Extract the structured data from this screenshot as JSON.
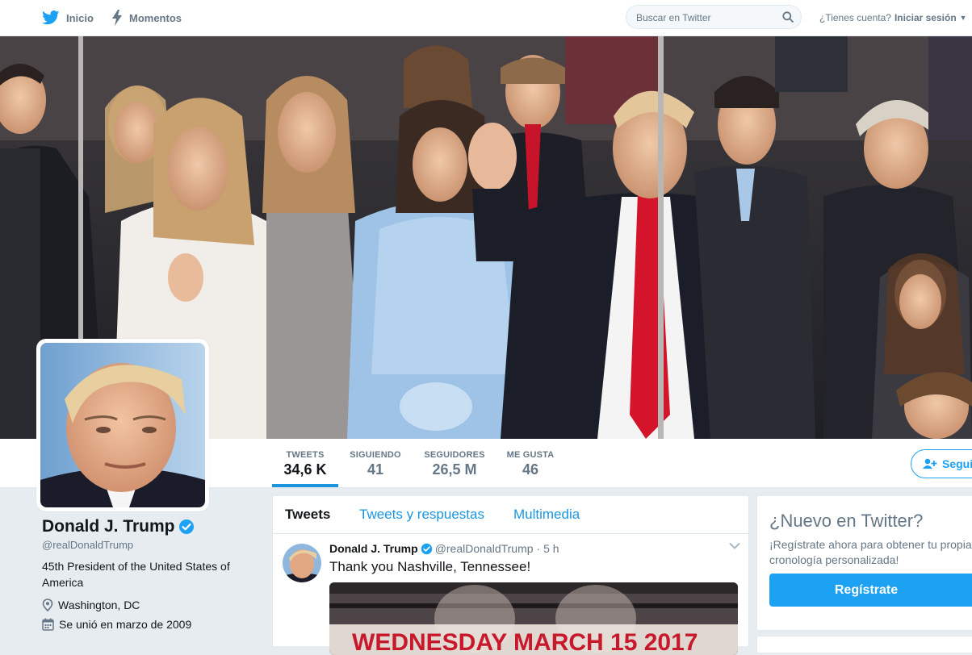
{
  "nav": {
    "home_label": "Inicio",
    "moments_label": "Momentos",
    "search_placeholder": "Buscar en Twitter",
    "have_account": "¿Tienes cuenta?",
    "login_label": "Iniciar sesión"
  },
  "profile_nav": {
    "stats": [
      {
        "label": "TWEETS",
        "value": "34,6 K"
      },
      {
        "label": "SIGUIENDO",
        "value": "41"
      },
      {
        "label": "SEGUIDORES",
        "value": "26,5 M"
      },
      {
        "label": "ME GUSTA",
        "value": "46"
      }
    ],
    "follow_label": "Seguir"
  },
  "profile": {
    "name": "Donald J. Trump",
    "handle": "@realDonaldTrump",
    "bio": "45th President of the United States of America",
    "location": "Washington, DC",
    "joined": "Se unió en marzo de 2009"
  },
  "timeline": {
    "tabs": [
      "Tweets",
      "Tweets y respuestas",
      "Multimedia"
    ],
    "tweet": {
      "name": "Donald J. Trump",
      "handle": "@realDonaldTrump",
      "time": "· 5 h",
      "text": "Thank you Nashville, Tennessee!",
      "media_text": "WEDNESDAY MARCH 15 2017"
    }
  },
  "sidebar": {
    "new_title": "¿Nuevo en Twitter?",
    "new_text": "¡Regístrate ahora para obtener tu propia cronología personalizada!",
    "signup_label": "Regístrate"
  },
  "colors": {
    "accent": "#1da1f2",
    "link": "#1b95e0",
    "page_bg": "#e6ecf0"
  }
}
